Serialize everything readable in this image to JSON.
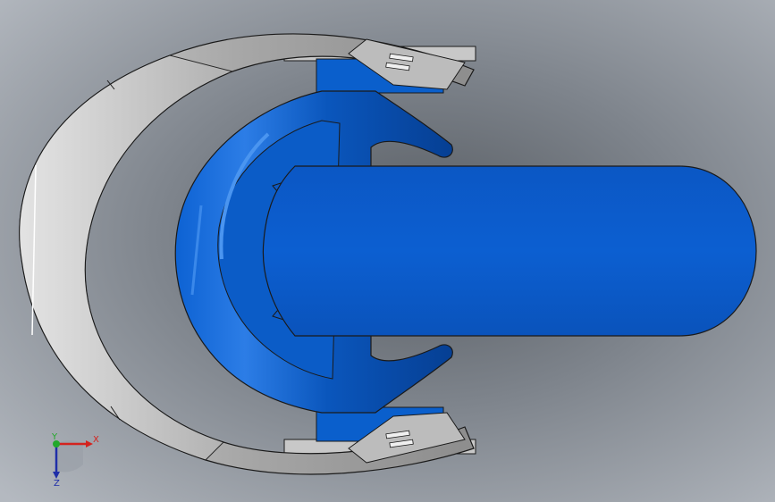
{
  "viewport": {
    "background_top": "#a6acb5",
    "background_mid": "#595e64",
    "background_bottom": "#aeb3bb",
    "part_color": "#0a5fcc",
    "part_shade": "#0647a6",
    "part_dark": "#05337d",
    "sheet_metal_color": "#b9b9b9",
    "sheet_metal_light": "#e2e2e2",
    "sheet_metal_dark": "#7d7d7d",
    "outline_color": "#1a1a1a"
  },
  "triad": {
    "x_label": "X",
    "y_label": "Y",
    "z_label": "Z",
    "x_color": "#d4231e",
    "y_color": "#22a92a",
    "z_color": "#1f2ea8"
  }
}
